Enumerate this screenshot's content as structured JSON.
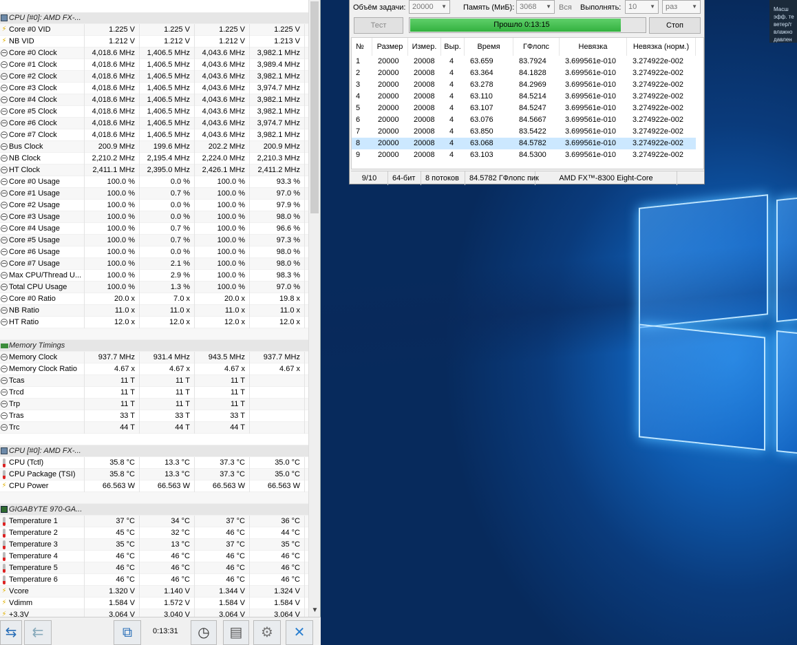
{
  "hwinfo": {
    "rows": [
      {
        "type": "header",
        "icon": "cpu-chip",
        "label": "CPU [#0]: AMD FX-..."
      },
      {
        "icon": "volt",
        "label": "Core #0 VID",
        "v": [
          "1.225 V",
          "1.225 V",
          "1.225 V",
          "1.225 V"
        ]
      },
      {
        "icon": "volt",
        "label": "NB VID",
        "v": [
          "1.212 V",
          "1.212 V",
          "1.212 V",
          "1.213 V"
        ]
      },
      {
        "icon": "clock",
        "label": "Core #0 Clock",
        "v": [
          "4,018.6 MHz",
          "1,406.5 MHz",
          "4,043.6 MHz",
          "3,982.1 MHz"
        ]
      },
      {
        "icon": "clock",
        "label": "Core #1 Clock",
        "v": [
          "4,018.6 MHz",
          "1,406.5 MHz",
          "4,043.6 MHz",
          "3,989.4 MHz"
        ]
      },
      {
        "icon": "clock",
        "label": "Core #2 Clock",
        "v": [
          "4,018.6 MHz",
          "1,406.5 MHz",
          "4,043.6 MHz",
          "3,982.1 MHz"
        ]
      },
      {
        "icon": "clock",
        "label": "Core #3 Clock",
        "v": [
          "4,018.6 MHz",
          "1,406.5 MHz",
          "4,043.6 MHz",
          "3,974.7 MHz"
        ]
      },
      {
        "icon": "clock",
        "label": "Core #4 Clock",
        "v": [
          "4,018.6 MHz",
          "1,406.5 MHz",
          "4,043.6 MHz",
          "3,982.1 MHz"
        ]
      },
      {
        "icon": "clock",
        "label": "Core #5 Clock",
        "v": [
          "4,018.6 MHz",
          "1,406.5 MHz",
          "4,043.6 MHz",
          "3,982.1 MHz"
        ]
      },
      {
        "icon": "clock",
        "label": "Core #6 Clock",
        "v": [
          "4,018.6 MHz",
          "1,406.5 MHz",
          "4,043.6 MHz",
          "3,974.7 MHz"
        ]
      },
      {
        "icon": "clock",
        "label": "Core #7 Clock",
        "v": [
          "4,018.6 MHz",
          "1,406.5 MHz",
          "4,043.6 MHz",
          "3,982.1 MHz"
        ]
      },
      {
        "icon": "clock",
        "label": "Bus Clock",
        "v": [
          "200.9 MHz",
          "199.6 MHz",
          "202.2 MHz",
          "200.9 MHz"
        ]
      },
      {
        "icon": "clock",
        "label": "NB Clock",
        "v": [
          "2,210.2 MHz",
          "2,195.4 MHz",
          "2,224.0 MHz",
          "2,210.3 MHz"
        ]
      },
      {
        "icon": "clock",
        "label": "HT Clock",
        "v": [
          "2,411.1 MHz",
          "2,395.0 MHz",
          "2,426.1 MHz",
          "2,411.2 MHz"
        ]
      },
      {
        "icon": "clock",
        "label": "Core #0 Usage",
        "v": [
          "100.0 %",
          "0.0 %",
          "100.0 %",
          "93.3 %"
        ]
      },
      {
        "icon": "clock",
        "label": "Core #1 Usage",
        "v": [
          "100.0 %",
          "0.7 %",
          "100.0 %",
          "97.0 %"
        ]
      },
      {
        "icon": "clock",
        "label": "Core #2 Usage",
        "v": [
          "100.0 %",
          "0.0 %",
          "100.0 %",
          "97.9 %"
        ]
      },
      {
        "icon": "clock",
        "label": "Core #3 Usage",
        "v": [
          "100.0 %",
          "0.0 %",
          "100.0 %",
          "98.0 %"
        ]
      },
      {
        "icon": "clock",
        "label": "Core #4 Usage",
        "v": [
          "100.0 %",
          "0.7 %",
          "100.0 %",
          "96.6 %"
        ]
      },
      {
        "icon": "clock",
        "label": "Core #5 Usage",
        "v": [
          "100.0 %",
          "0.7 %",
          "100.0 %",
          "97.3 %"
        ]
      },
      {
        "icon": "clock",
        "label": "Core #6 Usage",
        "v": [
          "100.0 %",
          "0.0 %",
          "100.0 %",
          "98.0 %"
        ]
      },
      {
        "icon": "clock",
        "label": "Core #7 Usage",
        "v": [
          "100.0 %",
          "2.1 %",
          "100.0 %",
          "98.0 %"
        ]
      },
      {
        "icon": "clock",
        "label": "Max CPU/Thread U...",
        "v": [
          "100.0 %",
          "2.9 %",
          "100.0 %",
          "98.3 %"
        ]
      },
      {
        "icon": "clock",
        "label": "Total CPU Usage",
        "v": [
          "100.0 %",
          "1.3 %",
          "100.0 %",
          "97.0 %"
        ]
      },
      {
        "icon": "clock",
        "label": "Core #0 Ratio",
        "v": [
          "20.0 x",
          "7.0 x",
          "20.0 x",
          "19.8 x"
        ]
      },
      {
        "icon": "clock",
        "label": "NB Ratio",
        "v": [
          "11.0 x",
          "11.0 x",
          "11.0 x",
          "11.0 x"
        ]
      },
      {
        "icon": "clock",
        "label": "HT Ratio",
        "v": [
          "12.0 x",
          "12.0 x",
          "12.0 x",
          "12.0 x"
        ]
      },
      {
        "type": "blank"
      },
      {
        "type": "header",
        "icon": "memory",
        "label": "Memory Timings"
      },
      {
        "icon": "clock",
        "label": "Memory Clock",
        "v": [
          "937.7 MHz",
          "931.4 MHz",
          "943.5 MHz",
          "937.7 MHz"
        ]
      },
      {
        "icon": "clock",
        "label": "Memory Clock Ratio",
        "v": [
          "4.67 x",
          "4.67 x",
          "4.67 x",
          "4.67 x"
        ]
      },
      {
        "icon": "clock",
        "label": "Tcas",
        "v": [
          "11 T",
          "11 T",
          "11 T",
          ""
        ]
      },
      {
        "icon": "clock",
        "label": "Trcd",
        "v": [
          "11 T",
          "11 T",
          "11 T",
          ""
        ]
      },
      {
        "icon": "clock",
        "label": "Trp",
        "v": [
          "11 T",
          "11 T",
          "11 T",
          ""
        ]
      },
      {
        "icon": "clock",
        "label": "Tras",
        "v": [
          "33 T",
          "33 T",
          "33 T",
          ""
        ]
      },
      {
        "icon": "clock",
        "label": "Trc",
        "v": [
          "44 T",
          "44 T",
          "44 T",
          ""
        ]
      },
      {
        "type": "blank"
      },
      {
        "type": "header",
        "icon": "cpu-chip",
        "label": "CPU [#0]: AMD FX-..."
      },
      {
        "icon": "temp",
        "label": "CPU (Tctl)",
        "v": [
          "35.8 °C",
          "13.3 °C",
          "37.3 °C",
          "35.0 °C"
        ]
      },
      {
        "icon": "temp",
        "label": "CPU Package (TSI)",
        "v": [
          "35.8 °C",
          "13.3 °C",
          "37.3 °C",
          "35.0 °C"
        ]
      },
      {
        "icon": "power",
        "label": "CPU Power",
        "v": [
          "66.563 W",
          "66.563 W",
          "66.563 W",
          "66.563 W"
        ]
      },
      {
        "type": "blank"
      },
      {
        "type": "header",
        "icon": "board",
        "label": "GIGABYTE 970-GA..."
      },
      {
        "icon": "temp",
        "label": "Temperature 1",
        "v": [
          "37 °C",
          "34 °C",
          "37 °C",
          "36 °C"
        ]
      },
      {
        "icon": "temp",
        "label": "Temperature 2",
        "v": [
          "45 °C",
          "32 °C",
          "46 °C",
          "44 °C"
        ]
      },
      {
        "icon": "temp",
        "label": "Temperature 3",
        "v": [
          "35 °C",
          "13 °C",
          "37 °C",
          "35 °C"
        ]
      },
      {
        "icon": "temp",
        "label": "Temperature 4",
        "v": [
          "46 °C",
          "46 °C",
          "46 °C",
          "46 °C"
        ]
      },
      {
        "icon": "temp",
        "label": "Temperature 5",
        "v": [
          "46 °C",
          "46 °C",
          "46 °C",
          "46 °C"
        ]
      },
      {
        "icon": "temp",
        "label": "Temperature 6",
        "v": [
          "46 °C",
          "46 °C",
          "46 °C",
          "46 °C"
        ]
      },
      {
        "icon": "volt",
        "label": "Vcore",
        "v": [
          "1.320 V",
          "1.140 V",
          "1.344 V",
          "1.324 V"
        ]
      },
      {
        "icon": "volt",
        "label": "Vdimm",
        "v": [
          "1.584 V",
          "1.572 V",
          "1.584 V",
          "1.584 V"
        ]
      },
      {
        "icon": "volt",
        "label": "+3.3V",
        "v": [
          "3.064 V",
          "3.040 V",
          "3.064 V",
          "3.064 V"
        ]
      }
    ],
    "toolbar": {
      "elapsed": "0:13:31",
      "icons": [
        "nav-arrows-icon",
        "nav-arrows-back-icon",
        "network-icon",
        "clock-icon",
        "report-icon",
        "settings-icon",
        "close-icon"
      ]
    }
  },
  "linpack": {
    "task_size_label": "Объём задачи:",
    "task_size_value": "20000",
    "memory_label": "Память (МиБ):",
    "memory_value": "3068",
    "memory_all": "Вся",
    "run_label": "Выполнять:",
    "run_value": "10",
    "run_unit": "раз",
    "test_button": "Тест",
    "stop_button": "Стоп",
    "progress_text": "Прошло 0:13:15",
    "progress_fraction": 0.94,
    "columns": [
      "№",
      "Размер",
      "Измер.",
      "Выр.",
      "Время",
      "ГФлопс",
      "Невязка",
      "Невязка (норм.)"
    ],
    "results": [
      [
        "1",
        "20000",
        "20008",
        "4",
        "63.659",
        "83.7924",
        "3.699561e-010",
        "3.274922e-002"
      ],
      [
        "2",
        "20000",
        "20008",
        "4",
        "63.364",
        "84.1828",
        "3.699561e-010",
        "3.274922e-002"
      ],
      [
        "3",
        "20000",
        "20008",
        "4",
        "63.278",
        "84.2969",
        "3.699561e-010",
        "3.274922e-002"
      ],
      [
        "4",
        "20000",
        "20008",
        "4",
        "63.110",
        "84.5214",
        "3.699561e-010",
        "3.274922e-002"
      ],
      [
        "5",
        "20000",
        "20008",
        "4",
        "63.107",
        "84.5247",
        "3.699561e-010",
        "3.274922e-002"
      ],
      [
        "6",
        "20000",
        "20008",
        "4",
        "63.076",
        "84.5667",
        "3.699561e-010",
        "3.274922e-002"
      ],
      [
        "7",
        "20000",
        "20008",
        "4",
        "63.850",
        "83.5422",
        "3.699561e-010",
        "3.274922e-002"
      ],
      [
        "8",
        "20000",
        "20008",
        "4",
        "63.068",
        "84.5782",
        "3.699561e-010",
        "3.274922e-002"
      ],
      [
        "9",
        "20000",
        "20008",
        "4",
        "63.103",
        "84.5300",
        "3.699561e-010",
        "3.274922e-002"
      ]
    ],
    "selected_row": 7,
    "status": [
      "9/10",
      "64-бит",
      "8 потоков",
      "84.5782 ГФлопс пик",
      "AMD FX™-8300 Eight-Core"
    ]
  },
  "notification": {
    "lines": [
      "Масш",
      "эфф. те",
      "ветер/т",
      "влажно",
      "давлен"
    ]
  },
  "colors": {
    "progress_green": "#33b13f",
    "selected_row": "#cce8ff",
    "desktop_blue": "#0f5bb0"
  }
}
